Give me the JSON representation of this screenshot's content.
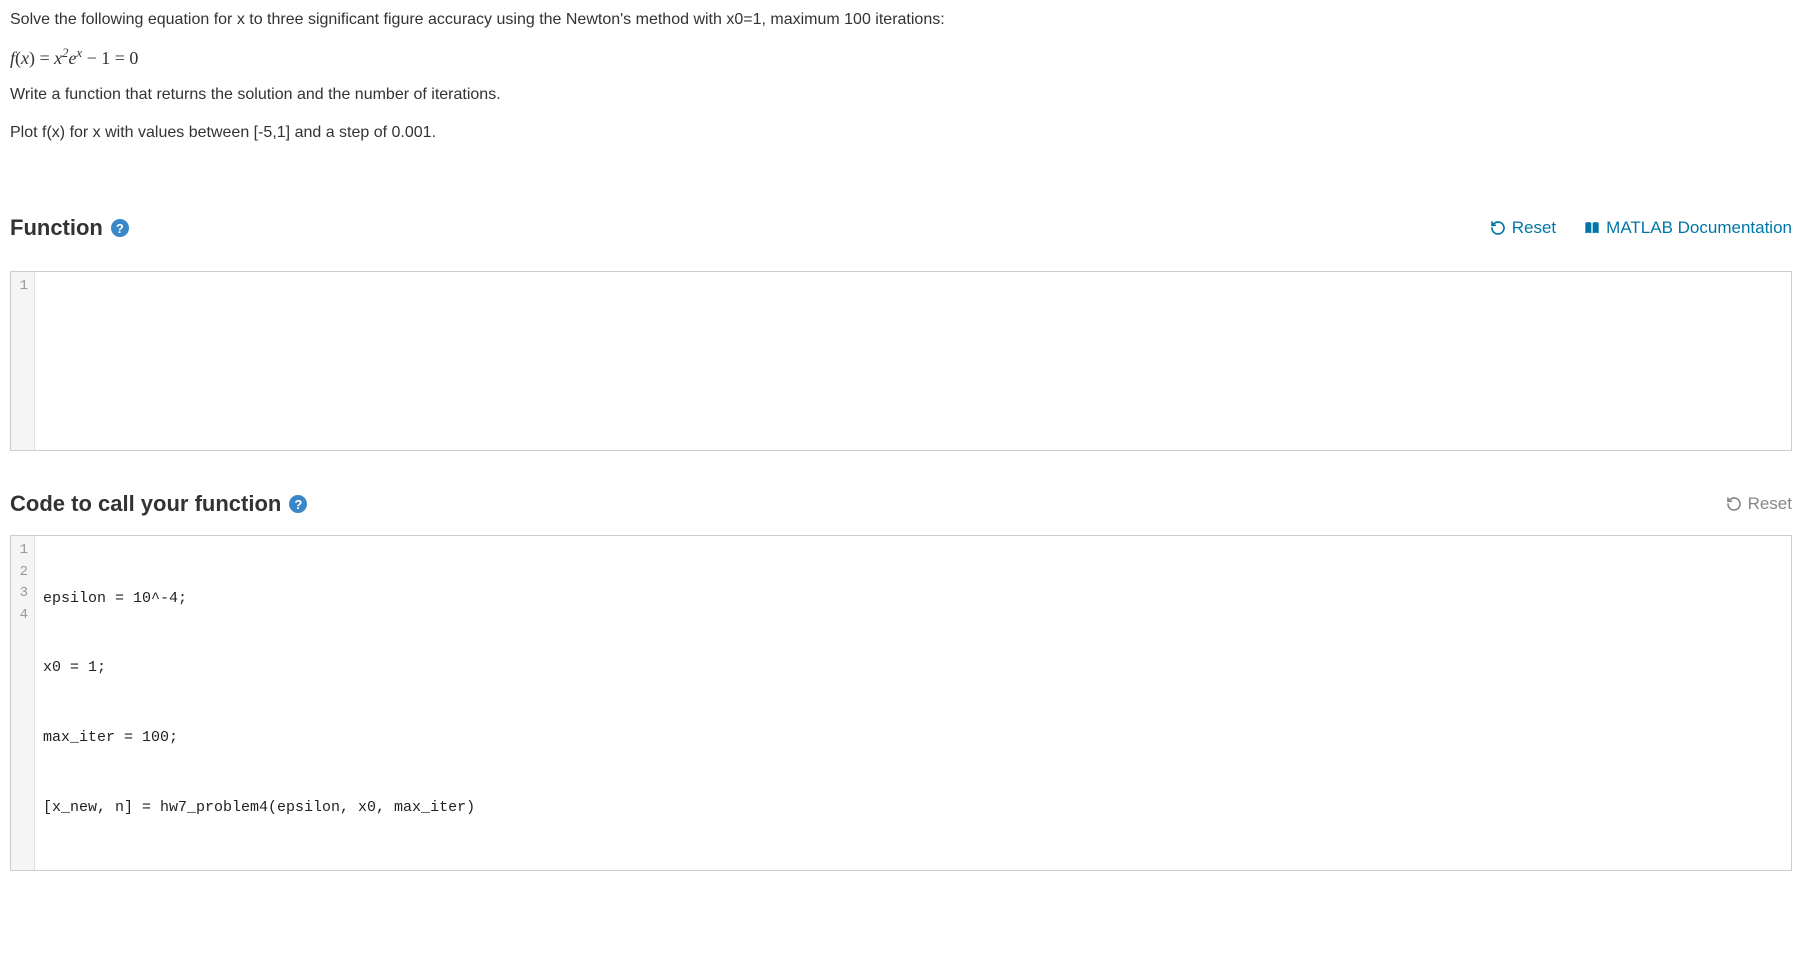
{
  "problem": {
    "line1": "Solve the following equation for x to three significant figure accuracy using the Newton's method with x0=1, maximum 100 iterations:",
    "equation_parts": {
      "p1": "f",
      "p2": "(",
      "p3": "x",
      "p4": ") = ",
      "p5": "x",
      "p6": "2",
      "p7": "e",
      "p8": "x",
      "p9": " − 1 = 0"
    },
    "line2": "Write a function that returns the solution and the number of iterations.",
    "line3": "Plot f(x) for x with values between [-5,1] and a step of 0.001."
  },
  "sections": {
    "function": {
      "title": "Function",
      "reset_label": "Reset",
      "doc_label": "MATLAB Documentation"
    },
    "call": {
      "title": "Code to call your function",
      "reset_label": "Reset"
    }
  },
  "editor1": {
    "gutters": [
      "1"
    ],
    "lines": [
      ""
    ]
  },
  "editor2": {
    "gutters": [
      "1",
      "2",
      "3",
      "4"
    ],
    "lines": [
      "epsilon = 10^-4;",
      "x0 = 1;",
      "max_iter = 100;",
      "[x_new, n] = hw7_problem4(epsilon, x0, max_iter)"
    ]
  },
  "icons": {
    "help": "?",
    "reset": "reset-icon",
    "book": "book-icon"
  }
}
